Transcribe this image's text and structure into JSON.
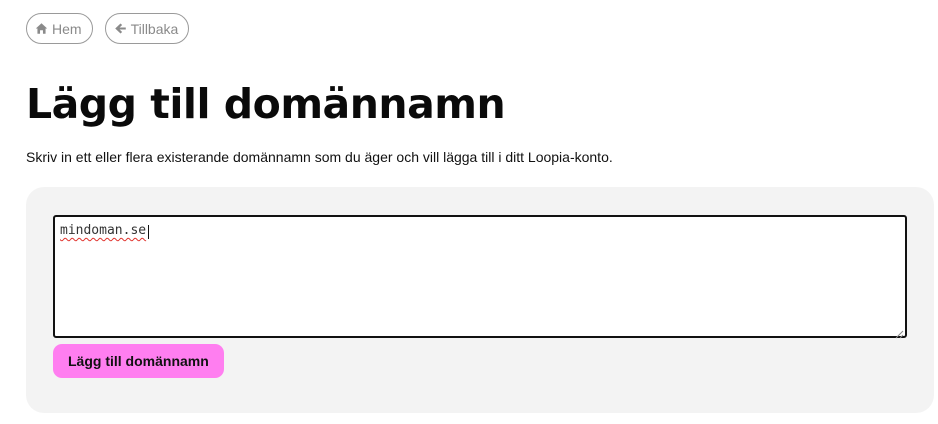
{
  "nav": {
    "home": {
      "label": "Hem",
      "icon": "home-icon"
    },
    "back": {
      "label": "Tillbaka",
      "icon": "arrow-left-icon"
    }
  },
  "page": {
    "title": "Lägg till domännamn",
    "intro": "Skriv in ett eller flera existerande domännamn som du äger och vill lägga till i ditt Loopia-konto."
  },
  "form": {
    "domains_value": "mindoman.se",
    "submit_label": "Lägg till domännamn"
  },
  "colors": {
    "accent_button": "#ff7ef0",
    "panel_background": "#f3f3f3",
    "pill_border": "#9a9a9a"
  }
}
